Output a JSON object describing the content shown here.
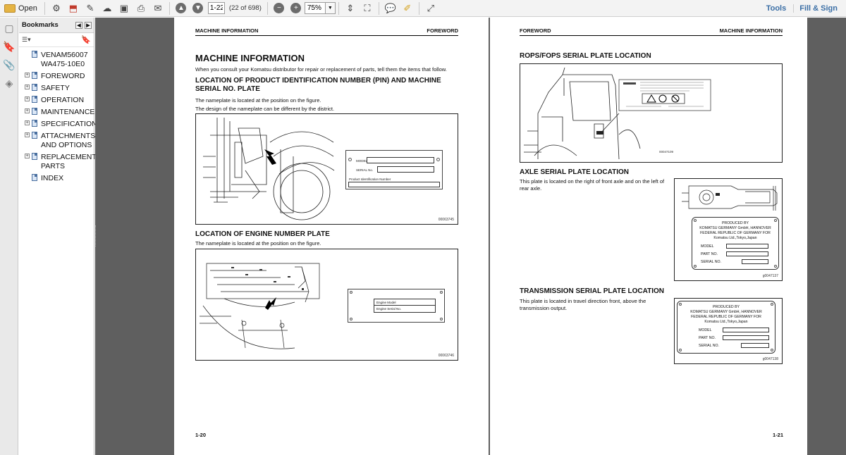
{
  "toolbar": {
    "open_label": "Open",
    "page_value": "1-22",
    "page_of": "(22 of 698)",
    "zoom_value": "75%",
    "tools_label": "Tools",
    "fill_sign_label": "Fill & Sign"
  },
  "bookmarks": {
    "title": "Bookmarks",
    "items": [
      {
        "label": "VENAM56007 WA475-10E0",
        "expandable": false
      },
      {
        "label": "FOREWORD",
        "expandable": true
      },
      {
        "label": "SAFETY",
        "expandable": true
      },
      {
        "label": "OPERATION",
        "expandable": true
      },
      {
        "label": "MAINTENANCE",
        "expandable": true
      },
      {
        "label": "SPECIFICATIONS",
        "expandable": true
      },
      {
        "label": "ATTACHMENTS AND OPTIONS",
        "expandable": true
      },
      {
        "label": "REPLACEMENT PARTS",
        "expandable": true
      },
      {
        "label": "INDEX",
        "expandable": false
      }
    ]
  },
  "left_page": {
    "header_left": "MACHINE INFORMATION",
    "header_right": "FOREWORD",
    "title": "MACHINE INFORMATION",
    "intro": "When you consult your Komatsu distributor for repair or replacement of parts, tell them the items that follow.",
    "section1_title": "LOCATION OF PRODUCT IDENTIFICATION NUMBER (PIN) AND MACHINE SERIAL NO. PLATE",
    "section1_p1": "The nameplate is located at the position on the figure.",
    "section1_p2": "The design of the nameplate can be different by the district.",
    "fig1": {
      "code": "00063745",
      "plate_model": "MODEL",
      "plate_serial": "SERIAL No.",
      "plate_pin": "Product Identification Number"
    },
    "section2_title": "LOCATION OF ENGINE NUMBER PLATE",
    "section2_p1": "The nameplate is located at the position on the figure.",
    "fig2": {
      "code": "00063746",
      "plate_model": "Engine Model",
      "plate_serial": "Engine Serial No."
    },
    "page_number": "1-20"
  },
  "right_page": {
    "header_left": "FOREWORD",
    "header_right": "MACHINE INFORMATION",
    "section1_title": "ROPS/FOPS SERIAL PLATE LOCATION",
    "fig1_code": "00047109",
    "section2_title": "AXLE SERIAL PLATE LOCATION",
    "section2_text": "This plate is located on the right of front axle and on the left of rear axle.",
    "axle_plate": {
      "line1": "PRODUCED BY",
      "line2": "KOMATSU GERMANY GmbH, HANNOVER",
      "line3": "FEDERAL REPUBLIC OF GERMANY FOR",
      "line4": "Komatsu Ltd.,Tokyo,Japan",
      "model": "MODEL",
      "part": "PART NO.",
      "serial": "SERIAL NO.",
      "code": "g0047137"
    },
    "section3_title": "TRANSMISSION SERIAL PLATE LOCATION",
    "section3_text": "This plate is located in travel direction front, above the transmission output.",
    "trans_plate": {
      "line1": "PRODUCED BY",
      "line2": "KOMATSU GERMANY GmbH, HANNOVER",
      "line3": "FEDERAL REPUBLIC OF GERMANY FOR",
      "line4": "Komatsu Ltd.,Tokyo,Japan",
      "model": "MODEL",
      "part": "PART NO.",
      "serial": "SERIAL NO.",
      "code": "g0047138"
    },
    "page_number": "1-21"
  }
}
